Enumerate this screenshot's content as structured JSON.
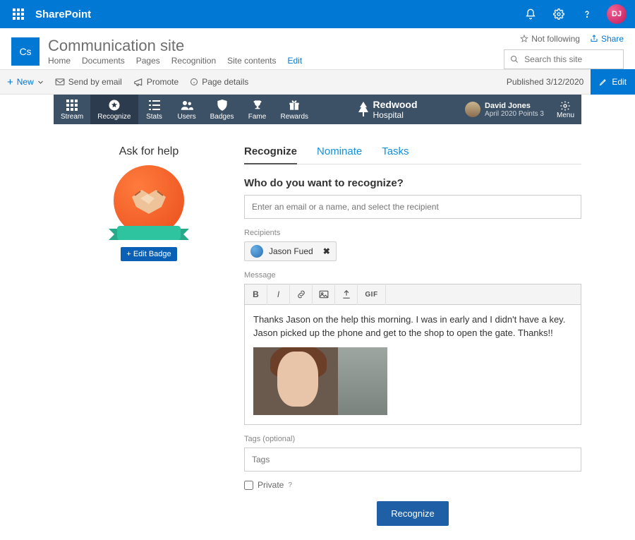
{
  "sp": {
    "productName": "SharePoint",
    "avatarInitials": "DJ",
    "siteLogoText": "Cs",
    "siteName": "Communication site",
    "nav": [
      "Home",
      "Documents",
      "Pages",
      "Recognition",
      "Site contents",
      "Edit"
    ],
    "notFollowing": "Not following",
    "share": "Share",
    "searchPlaceholder": "Search this site",
    "cmdbar": {
      "new": "New",
      "sendEmail": "Send by email",
      "promote": "Promote",
      "pageDetails": "Page details",
      "published": "Published 3/12/2020",
      "edit": "Edit"
    }
  },
  "app": {
    "tabs": [
      "Stream",
      "Recognize",
      "Stats",
      "Users",
      "Badges",
      "Fame",
      "Rewards"
    ],
    "brandTop": "Redwood",
    "brandBottom": "Hospital",
    "userName": "David Jones",
    "userSub": "April 2020 Points 3",
    "menu": "Menu"
  },
  "left": {
    "title": "Ask for help",
    "editBadge": "+ Edit Badge"
  },
  "form": {
    "tabs": [
      "Recognize",
      "Nominate",
      "Tasks"
    ],
    "whoTitle": "Who do you want to recognize?",
    "recipientPlaceholder": "Enter an email or a name, and select the recipient",
    "recipientsLabel": "Recipients",
    "recipientName": "Jason Fued",
    "messageLabel": "Message",
    "messageText": "Thanks Jason on the help this morning. I was in early and I didn't have a key. Jason picked up the phone and get to the shop to open the gate. Thanks!!",
    "gifLabel": "GIF",
    "tagsLabel": "Tags (optional)",
    "tagsPlaceholder": "Tags",
    "private": "Private",
    "recognizeBtn": "Recognize"
  }
}
